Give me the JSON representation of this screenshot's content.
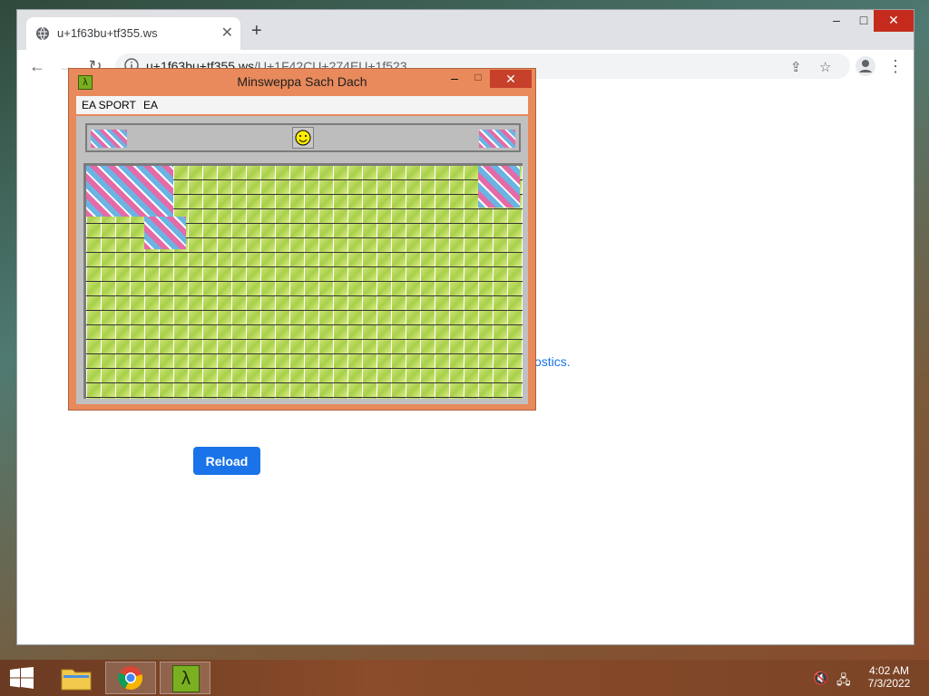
{
  "browser": {
    "tab_title": "u+1f63bu+tf355.ws",
    "tab_close": "✕",
    "new_tab": "+",
    "url_host": "u+1f63bu+tf355.ws",
    "url_path": "/U+1F42CU+274EU+1f523",
    "window_controls": {
      "minimize": "–",
      "maximize": "□",
      "close": "✕"
    }
  },
  "page": {
    "diagnostics_fragment": "ostics.",
    "reload_label": "Reload"
  },
  "game": {
    "title": "Minsweppa Sach Dach",
    "app_icon": "λ",
    "menu": [
      "EA SPORT",
      "EA"
    ],
    "controls": {
      "minimize": "–",
      "maximize": "□",
      "close": "✕"
    },
    "smiley": "☺"
  },
  "taskbar": {
    "time": "4:02 AM",
    "date": "7/3/2022",
    "apps": [
      "file-explorer",
      "chrome",
      "lambda-app"
    ]
  },
  "colors": {
    "accent": "#1a73e8",
    "game_frame": "#e88a5c",
    "close_red": "#c7402a",
    "tile_green": "#a8d04a",
    "tile_pink": "#e46aa8",
    "tile_blue": "#6ab4e4"
  }
}
